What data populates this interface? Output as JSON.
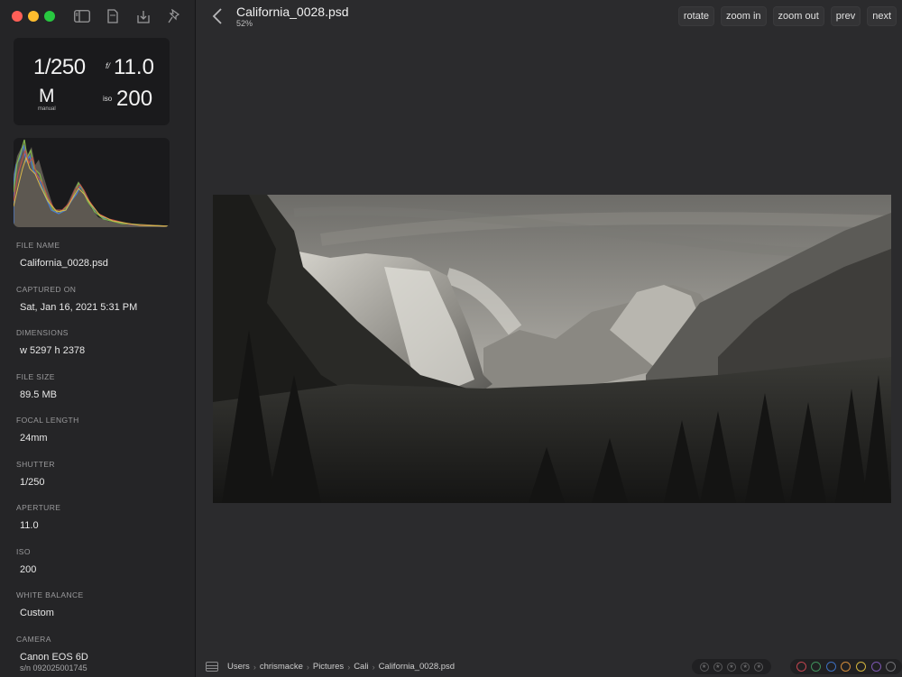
{
  "window": {
    "traffic_lights": [
      "close",
      "minimize",
      "maximize"
    ],
    "sidebar_tools": [
      "sidebar-toggle-icon",
      "document-icon",
      "download-icon",
      "pin-icon"
    ]
  },
  "exif_summary": {
    "shutter": "1/250",
    "aperture_prefix": "f/",
    "aperture": "11.0",
    "mode": "M",
    "mode_label": "manual",
    "iso_prefix": "iso",
    "iso": "200"
  },
  "histogram": {
    "channels": [
      "red",
      "green",
      "blue",
      "luminance"
    ],
    "colors": {
      "red": "#c0504d",
      "green": "#7fb04a",
      "blue": "#4a7bd0",
      "yellow": "#d9b84a"
    }
  },
  "metadata": [
    {
      "label": "FILE NAME",
      "value": "California_0028.psd"
    },
    {
      "label": "CAPTURED ON",
      "value": "Sat, Jan 16, 2021 5:31 PM"
    },
    {
      "label": "DIMENSIONS",
      "value": "w 5297   h 2378"
    },
    {
      "label": "FILE SIZE",
      "value": "89.5 MB"
    },
    {
      "label": "FOCAL LENGTH",
      "value": "24mm"
    },
    {
      "label": "SHUTTER",
      "value": "1/250"
    },
    {
      "label": "APERTURE",
      "value": "11.0"
    },
    {
      "label": "ISO",
      "value": "200"
    },
    {
      "label": "WHITE BALANCE",
      "value": "Custom"
    },
    {
      "label": "CAMERA",
      "value": "Canon EOS 6D",
      "sub": "s/n 092025001745"
    }
  ],
  "header": {
    "title": "California_0028.psd",
    "zoom": "52%",
    "buttons": [
      "rotate",
      "zoom in",
      "zoom out",
      "prev",
      "next"
    ]
  },
  "breadcrumb": [
    "Users",
    "chrismacke",
    "Pictures",
    "Cali",
    "California_0028.psd"
  ],
  "rating": {
    "stars": 5,
    "value": 0
  },
  "color_labels": [
    {
      "name": "red",
      "color": "#c2454f"
    },
    {
      "name": "green",
      "color": "#3f8f5a"
    },
    {
      "name": "blue",
      "color": "#3d6fbf"
    },
    {
      "name": "orange",
      "color": "#d08a3a"
    },
    {
      "name": "yellow",
      "color": "#d2b43e"
    },
    {
      "name": "purple",
      "color": "#7b56b0"
    },
    {
      "name": "gray",
      "color": "#707074"
    }
  ]
}
